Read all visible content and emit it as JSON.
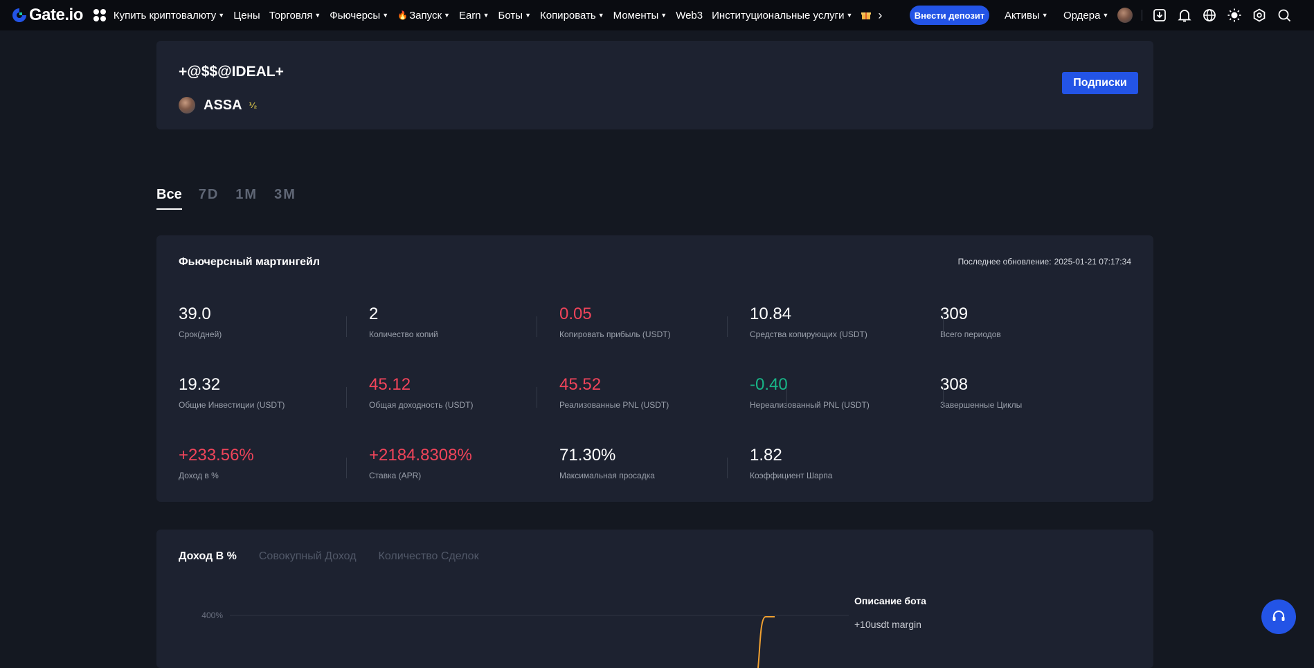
{
  "nav": {
    "logo_text": "Gate.io",
    "items": [
      {
        "label": "Купить криптовалюту",
        "caret": true
      },
      {
        "label": "Цены",
        "caret": false
      },
      {
        "label": "Торговля",
        "caret": true
      },
      {
        "label": "Фьючерсы",
        "caret": true
      },
      {
        "label": "Запуск",
        "caret": true
      },
      {
        "label": "Earn",
        "caret": true
      },
      {
        "label": "Боты",
        "caret": true
      },
      {
        "label": "Копировать",
        "caret": true
      },
      {
        "label": "Моменты",
        "caret": true
      },
      {
        "label": "Web3",
        "caret": false
      },
      {
        "label": "Институциональные услуги",
        "caret": true
      }
    ],
    "deposit_label": "Внести депозит",
    "assets_label": "Активы",
    "orders_label": "Ордера",
    "icons": [
      "download-icon",
      "bell-icon",
      "globe-icon",
      "sun-icon",
      "settings-icon",
      "search-icon"
    ],
    "accent": "#2354e6"
  },
  "profile": {
    "bot_name": "+@$$@IDEAL+",
    "owner_name": "ASSA",
    "owner_badge": "⅟₂",
    "subscribe_label": "Подписки"
  },
  "period_tabs": [
    "Все",
    "7D",
    "1M",
    "3M"
  ],
  "stats": {
    "title": "Фьючерсный мартингейл",
    "last_update_label": "Последнее обновление:",
    "last_update_value": "2025-01-21 07:17:34",
    "items": [
      {
        "value": "39.0",
        "label": "Срок(дней)",
        "color": "white"
      },
      {
        "value": "2",
        "label": "Количество копий",
        "color": "white"
      },
      {
        "value": "0.05",
        "label": "Копировать прибыль (USDT)",
        "color": "red"
      },
      {
        "value": "10.84",
        "label": "Средства копирующих (USDT)",
        "color": "white"
      },
      {
        "value": "309",
        "label": "Всего периодов",
        "color": "white"
      },
      {
        "value": "19.32",
        "label": "Общие Инвестиции (USDT)",
        "color": "white"
      },
      {
        "value": "45.12",
        "label": "Общая доходность (USDT)",
        "color": "red"
      },
      {
        "value": "45.52",
        "label": "Реализованные PNL (USDT)",
        "color": "red"
      },
      {
        "value": "-0.40",
        "label": "Нереализованный PNL (USDT)",
        "color": "green"
      },
      {
        "value": "308",
        "label": "Завершенные Циклы",
        "color": "white"
      },
      {
        "value": "+233.56%",
        "label": "Доход в %",
        "color": "red"
      },
      {
        "value": "+2184.8308%",
        "label": "Ставка (APR)",
        "color": "red"
      },
      {
        "value": "71.30%",
        "label": "Максимальная просадка",
        "color": "white"
      },
      {
        "value": "1.82",
        "label": "Коэффициент Шарпа",
        "color": "white"
      }
    ],
    "colors": {
      "red": "#f0445a",
      "green": "#18b587"
    }
  },
  "chart": {
    "tabs": [
      "Доход В %",
      "Совокупный Доход",
      "Количество Сделок"
    ],
    "active_tab": 0,
    "y_tick_label": "400%",
    "description_title": "Описание бота",
    "description_text": "+10usdt margin"
  }
}
